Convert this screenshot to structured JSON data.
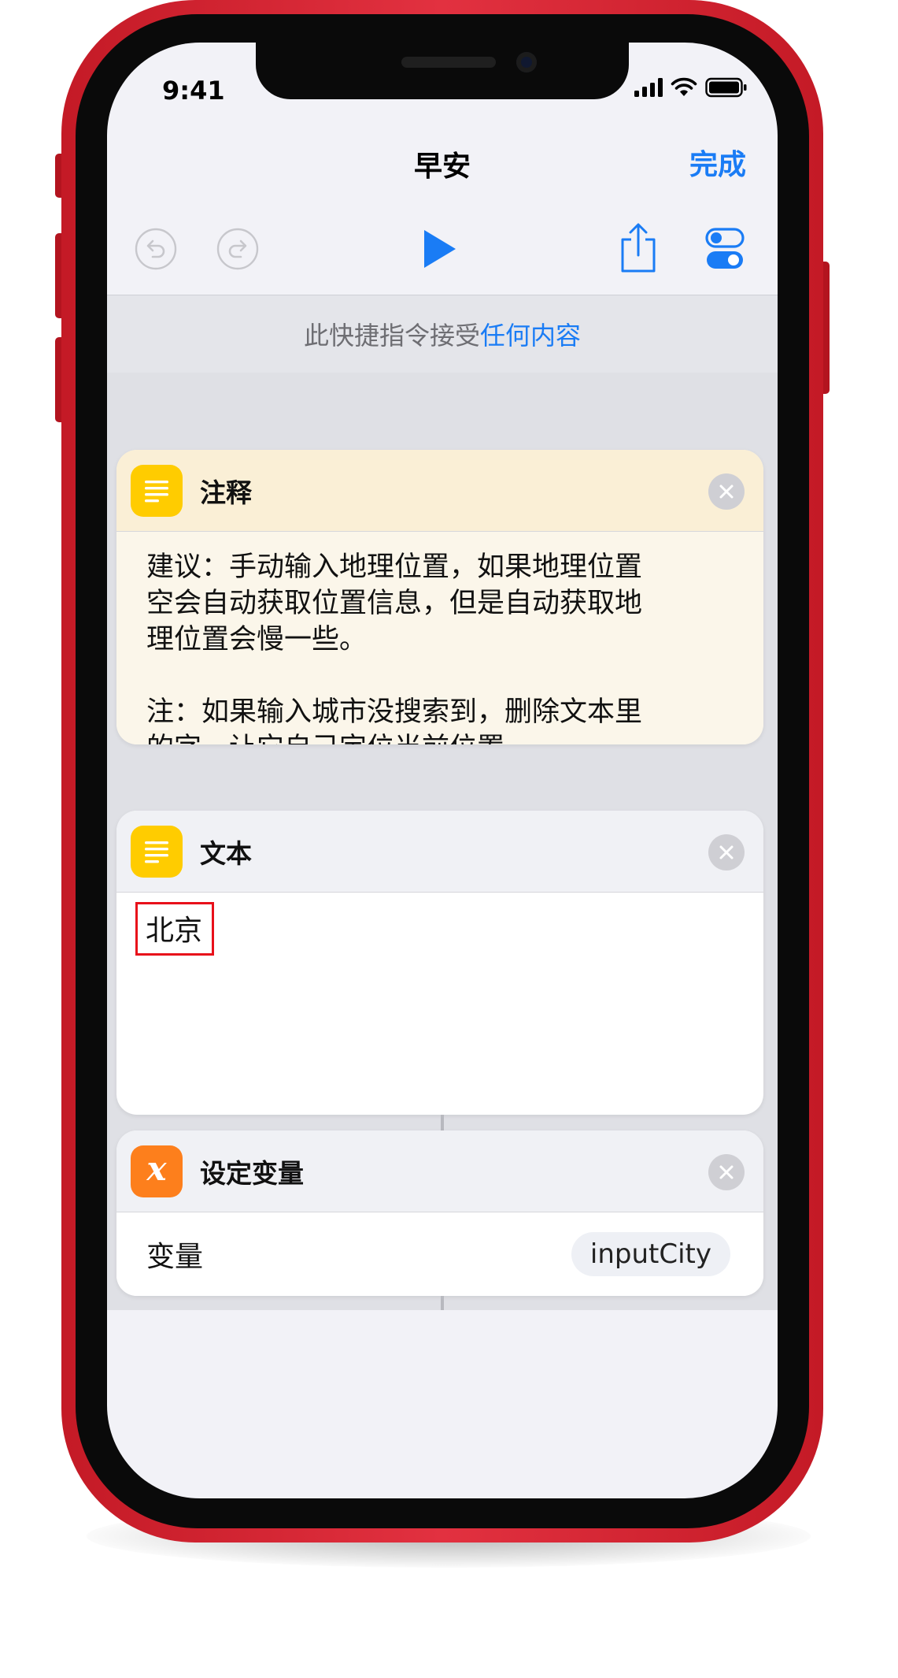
{
  "status_bar": {
    "time": "9:41"
  },
  "nav": {
    "title": "早安",
    "done_label": "完成"
  },
  "toolbar": {
    "undo_icon": "undo-icon",
    "redo_icon": "redo-icon",
    "play_icon": "play-icon",
    "share_icon": "share-icon",
    "settings_icon": "toggle-settings-icon",
    "accent_color": "#1a7cf5"
  },
  "accept_bar": {
    "prefix": "此快捷指令接受",
    "highlight": "任何内容"
  },
  "actions": [
    {
      "title": "注释",
      "icon": "notes-icon",
      "icon_color": "#ffcc00",
      "lines": [
        "建议：手动输入地理位置，如果地理位置",
        "空会自动获取位置信息，但是自动获取地",
        "理位置会慢一些。",
        "",
        "注：如果输入城市没搜索到，删除文本里",
        "的字，让它自己定位当前位置"
      ]
    },
    {
      "title": "文本",
      "icon": "text-icon",
      "icon_color": "#ffcc00",
      "value": "北京"
    },
    {
      "title": "设定变量",
      "icon": "variable-icon",
      "icon_color": "#fd7f1c",
      "icon_glyph": "x",
      "field_label": "变量",
      "field_value": "inputCity"
    }
  ]
}
